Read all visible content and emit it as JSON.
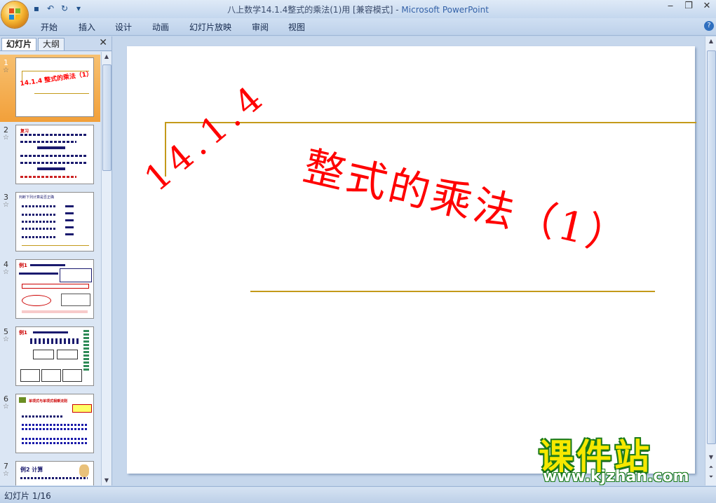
{
  "window": {
    "title_doc": "八上数学14.1.4整式的乘法(1)用 [兼容模式]",
    "title_sep": " - ",
    "title_app": "Microsoft PowerPoint",
    "controls": [
      "‒",
      "❐",
      "✕"
    ]
  },
  "qat": {
    "icons": [
      "save-icon",
      "undo-icon",
      "redo-icon",
      "customize-icon"
    ]
  },
  "menu": [
    "开始",
    "插入",
    "设计",
    "动画",
    "幻灯片放映",
    "审阅",
    "视图"
  ],
  "panel": {
    "tabs": [
      "幻灯片",
      "大纲"
    ],
    "close": "✕"
  },
  "thumbnails": [
    {
      "num": "1",
      "selected": true,
      "title": "14.1.4 整式的乘法（1）"
    },
    {
      "num": "2",
      "selected": false,
      "title": "复习"
    },
    {
      "num": "3",
      "selected": false,
      "title": "判断下列计算是否正确"
    },
    {
      "num": "4",
      "selected": false,
      "title": "例1"
    },
    {
      "num": "5",
      "selected": false,
      "title": "例1"
    },
    {
      "num": "6",
      "selected": false,
      "title": "单项式与单项式相乘法则"
    },
    {
      "num": "7",
      "selected": false,
      "title": "例2 计算"
    }
  ],
  "slide": {
    "number": "14.1.4",
    "title": "整式的乘法（1）",
    "accent_red": "#ff0000",
    "rule_color": "#c49a1a"
  },
  "status": {
    "text": "幻灯片 1/16"
  },
  "watermark": {
    "cn": "课件站",
    "url": "www.kjzhan.com"
  }
}
